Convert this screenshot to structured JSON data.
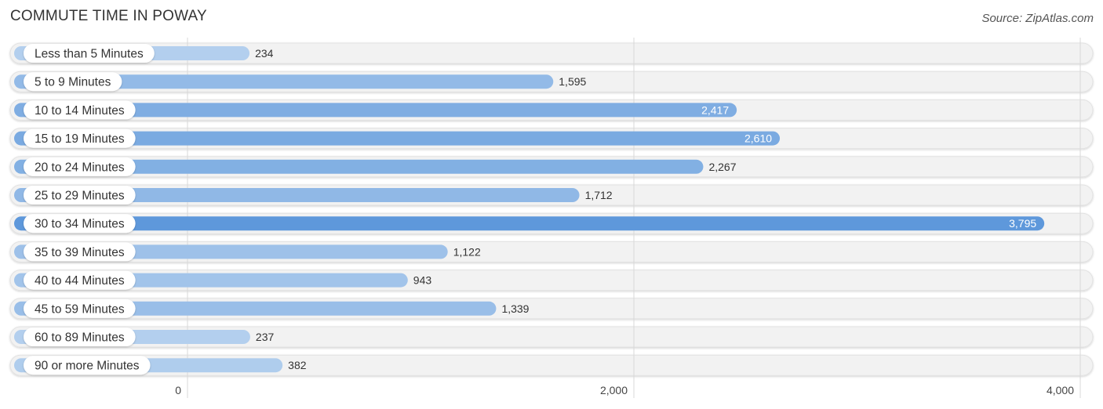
{
  "header": {
    "title": "COMMUTE TIME IN POWAY",
    "source": "Source: ZipAtlas.com"
  },
  "chart_data": {
    "type": "bar",
    "orientation": "horizontal",
    "title": "COMMUTE TIME IN POWAY",
    "xlabel": "",
    "ylabel": "",
    "categories": [
      "Less than 5 Minutes",
      "5 to 9 Minutes",
      "10 to 14 Minutes",
      "15 to 19 Minutes",
      "20 to 24 Minutes",
      "25 to 29 Minutes",
      "30 to 34 Minutes",
      "35 to 39 Minutes",
      "40 to 44 Minutes",
      "45 to 59 Minutes",
      "60 to 89 Minutes",
      "90 or more Minutes"
    ],
    "values": [
      234,
      1595,
      2417,
      2610,
      2267,
      1712,
      3795,
      1122,
      943,
      1339,
      237,
      382
    ],
    "value_labels": [
      "234",
      "1,595",
      "2,417",
      "2,610",
      "2,267",
      "1,712",
      "3,795",
      "1,122",
      "943",
      "1,339",
      "237",
      "382"
    ],
    "xlim": [
      0,
      4000
    ],
    "xticks": [
      0,
      2000,
      4000
    ],
    "xtick_labels": [
      "0",
      "2,000",
      "4,000"
    ],
    "grid": true,
    "legend": "none",
    "colors": {
      "bar_min": "#b3cfee",
      "bar_max": "#5e98db",
      "track": "#f2f2f2",
      "label_inside": "#ffffff",
      "label_outside": "#333333"
    }
  }
}
